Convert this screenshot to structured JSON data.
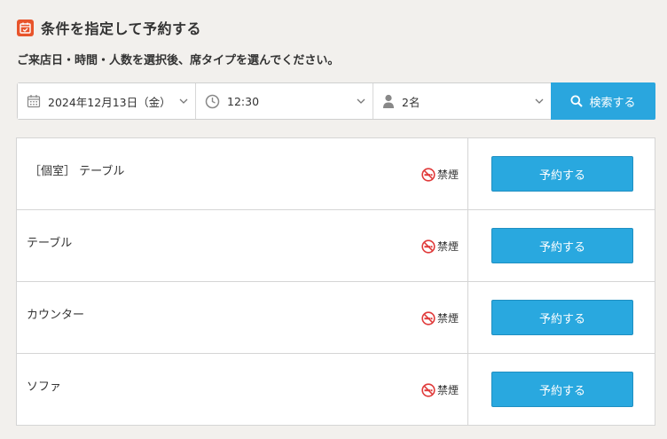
{
  "header": {
    "title": "条件を指定して予約する",
    "subtitle": "ご来店日・時間・人数を選択後、席タイプを選んでください。"
  },
  "search": {
    "date_value": "2024年12月13日（金）",
    "time_value": "12:30",
    "people_value": "2名",
    "button_label": "検索する"
  },
  "seats": [
    {
      "name": "［個室］ テーブル",
      "smoking": "禁煙",
      "button_label": "予約する"
    },
    {
      "name": "テーブル",
      "smoking": "禁煙",
      "button_label": "予約する"
    },
    {
      "name": "カウンター",
      "smoking": "禁煙",
      "button_label": "予約する"
    },
    {
      "name": "ソファ",
      "smoking": "禁煙",
      "button_label": "予約する"
    }
  ],
  "colors": {
    "accent": "#2aa6de",
    "badge": "#e8542b",
    "no_smoking": "#e03b3b",
    "background": "#f2f0ed"
  },
  "icons": {
    "title": "calendar-check-icon",
    "date": "calendar-icon",
    "time": "clock-icon",
    "people": "person-icon",
    "search": "search-icon",
    "smoking": "no-smoking-icon",
    "dropdown": "chevron-down-icon"
  }
}
